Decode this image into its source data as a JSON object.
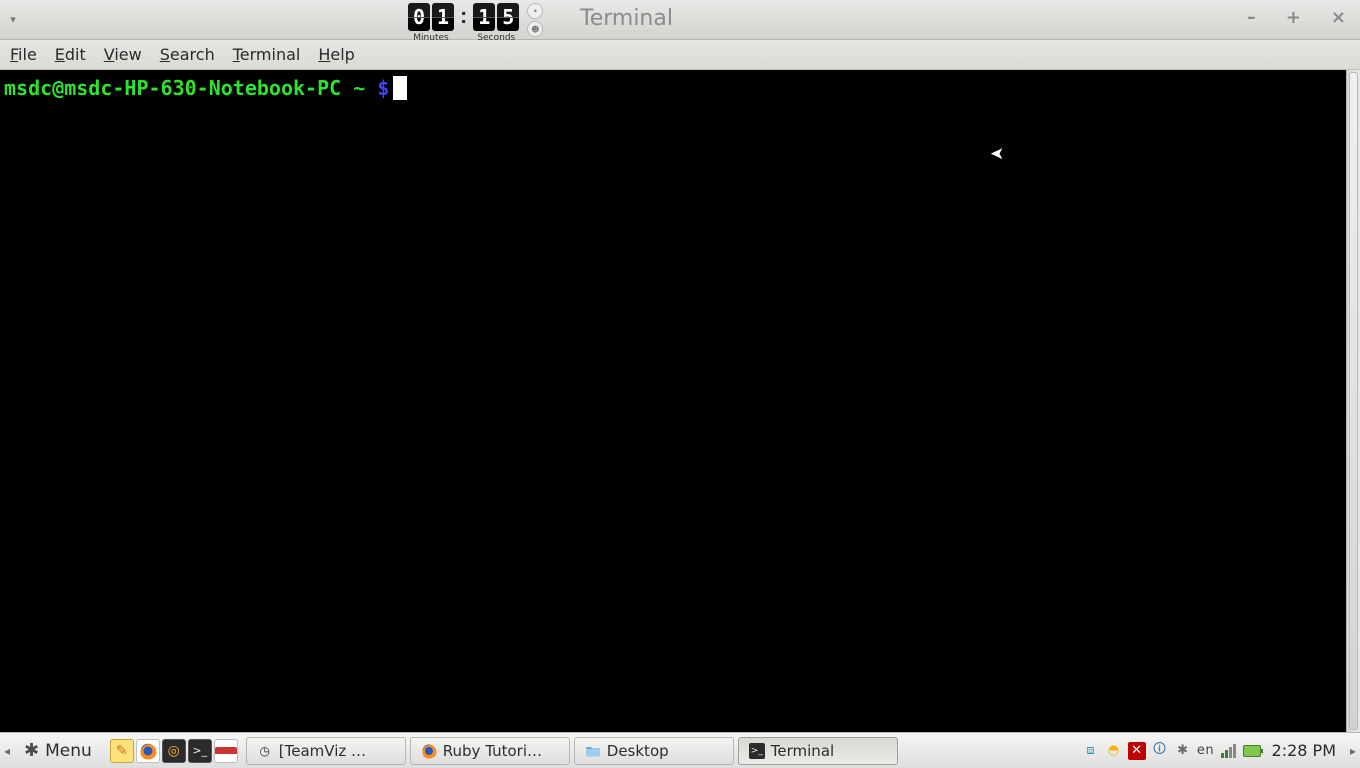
{
  "window": {
    "title": "Terminal",
    "controls": {
      "min": "–",
      "max": "+",
      "close": "×"
    }
  },
  "timer": {
    "minutes": "01",
    "seconds": "15",
    "minutes_label": "Minutes",
    "seconds_label": "Seconds"
  },
  "menubar": {
    "file": {
      "label": "File",
      "accel": "F"
    },
    "edit": {
      "label": "Edit",
      "accel": "E"
    },
    "view": {
      "label": "View",
      "accel": "V"
    },
    "search": {
      "label": "Search",
      "accel": "S"
    },
    "terminal": {
      "label": "Terminal",
      "accel": "T"
    },
    "help": {
      "label": "Help",
      "accel": "H"
    }
  },
  "prompt": {
    "user_host": "msdc@msdc-HP-630-Notebook-PC",
    "cwd": "~",
    "symbol": "$"
  },
  "panel": {
    "menu_label": "Menu",
    "tasks": [
      {
        "label": "[TeamViz …",
        "icon": "clock-icon",
        "active": false
      },
      {
        "label": "Ruby Tutori…",
        "icon": "firefox-icon",
        "active": false
      },
      {
        "label": "Desktop",
        "icon": "folder-icon",
        "active": false
      },
      {
        "label": "Terminal",
        "icon": "terminal-icon",
        "active": true
      }
    ],
    "lang": "en",
    "clock": "2:28 PM"
  }
}
